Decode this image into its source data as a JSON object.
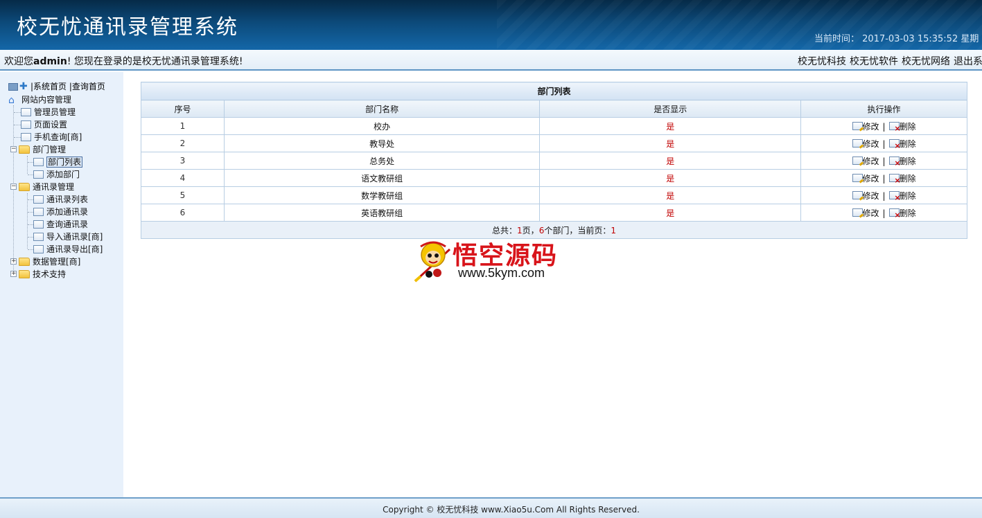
{
  "header": {
    "title": "校无忧通讯录管理系统",
    "time_label": "当前时间：",
    "time_value": "2017-03-03 15:35:52 星期"
  },
  "welcome": {
    "prefix": "欢迎您",
    "user": "admin",
    "suffix": "! 您现在登录的是校无忧通讯录管理系统!",
    "links": [
      "校无忧科技",
      "校无忧软件",
      "校无忧网络",
      "退出系"
    ]
  },
  "sidebar": {
    "top_links": [
      "系统首页",
      "查询首页"
    ],
    "root": "网站内容管理",
    "items": [
      {
        "label": "管理员管理"
      },
      {
        "label": "页面设置"
      },
      {
        "label": "手机查询[商]"
      },
      {
        "label": "部门管理"
      },
      {
        "label": "部门列表"
      },
      {
        "label": "添加部门"
      },
      {
        "label": "通讯录管理"
      },
      {
        "label": "通讯录列表"
      },
      {
        "label": "添加通讯录"
      },
      {
        "label": "查询通讯录"
      },
      {
        "label": "导入通讯录[商]"
      },
      {
        "label": "通讯录导出[商]"
      },
      {
        "label": "数据管理[商]"
      },
      {
        "label": "技术支持"
      }
    ]
  },
  "table": {
    "caption": "部门列表",
    "headers": [
      "序号",
      "部门名称",
      "是否显示",
      "执行操作"
    ],
    "rows": [
      {
        "no": "1",
        "name": "校办",
        "show": "是"
      },
      {
        "no": "2",
        "name": "教导处",
        "show": "是"
      },
      {
        "no": "3",
        "name": "总务处",
        "show": "是"
      },
      {
        "no": "4",
        "name": "语文教研组",
        "show": "是"
      },
      {
        "no": "5",
        "name": "数学教研组",
        "show": "是"
      },
      {
        "no": "6",
        "name": "英语教研组",
        "show": "是"
      }
    ],
    "edit_label": "修改",
    "delete_label": "删除",
    "separator": "|",
    "footer": {
      "t1": "总共：",
      "pages": "1",
      "t2": "页，",
      "count": "6",
      "t3": "个部门，当前页：",
      "current": "1"
    }
  },
  "watermark": {
    "brand": "悟空源码",
    "url": "www.5kym.com"
  },
  "footer": {
    "copyright": "Copyright © 校无忧科技  www.Xiao5u.Com All Rights Reserved."
  }
}
